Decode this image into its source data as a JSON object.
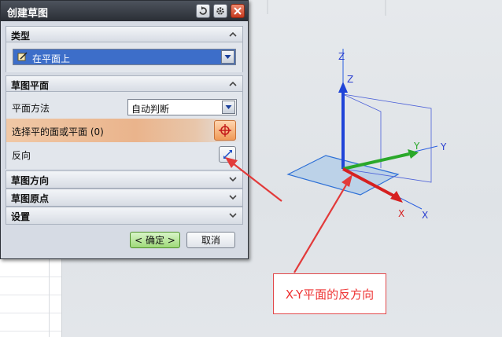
{
  "dialog": {
    "title": "创建草图",
    "sections": {
      "type": {
        "label": "类型",
        "value": "在平面上"
      },
      "plane": {
        "label": "草图平面",
        "method_label": "平面方法",
        "method_value": "自动判断",
        "select_label": "选择平的面或平面 (0)",
        "reverse_label": "反向"
      },
      "orientation": {
        "label": "草图方向"
      },
      "origin": {
        "label": "草图原点"
      },
      "settings": {
        "label": "设置"
      }
    },
    "ok_label": "< 确定 >",
    "cancel_label": "取消"
  },
  "triad": {
    "axes": [
      "X",
      "Y",
      "Z"
    ]
  },
  "annotation": {
    "text": "X-Y平面的反方向",
    "color": "#e33"
  },
  "colors": {
    "titlebar": "#2a2e35",
    "selection_highlight": "#eab48c",
    "combo_selected": "#3d6ec9"
  },
  "icons": [
    "undo-icon",
    "gear-icon",
    "close-icon",
    "sketch-plane-icon",
    "crosshair-icon",
    "reverse-direction-icon",
    "chevron-up-icon",
    "chevron-down-icon"
  ]
}
